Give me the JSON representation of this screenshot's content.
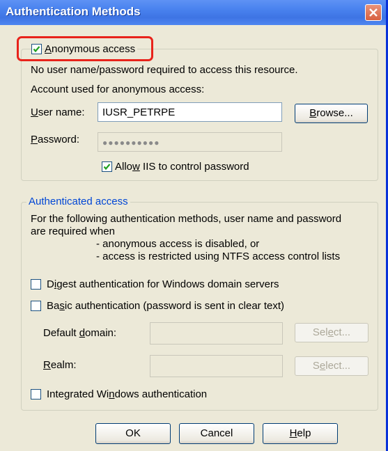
{
  "window": {
    "title": "Authentication Methods"
  },
  "anonymous": {
    "checkbox_label_pre": "",
    "checkbox_label_u": "A",
    "checkbox_label_post": "nonymous access",
    "checked": true,
    "description": "No user name/password required to access this resource.",
    "account_label": "Account used for anonymous access:",
    "username_label_u": "U",
    "username_label_post": "ser name:",
    "username_value": "IUSR_PETRPE",
    "browse_u": "B",
    "browse_post": "rowse...",
    "password_label_u": "P",
    "password_label_post": "assword:",
    "password_mask": "●●●●●●●●●●",
    "allow_pre": "Allo",
    "allow_u": "w",
    "allow_post": " IIS to control password",
    "allow_checked": true
  },
  "authenticated": {
    "legend": "Authenticated access",
    "desc_line1": "For the following authentication methods, user name and password",
    "desc_line2": "are required when",
    "desc_bullet1": "- anonymous access is disabled, or",
    "desc_bullet2": "- access is restricted using NTFS access control lists",
    "digest_pre": "D",
    "digest_u": "i",
    "digest_post": "gest authentication for Windows domain servers",
    "digest_checked": false,
    "basic_pre": "Ba",
    "basic_u": "s",
    "basic_post": "ic authentication (password is sent in clear text)",
    "basic_checked": false,
    "domain_pre": "Default ",
    "domain_u": "d",
    "domain_post": "omain:",
    "select1_pre": "Sel",
    "select1_u": "e",
    "select1_post": "ct...",
    "realm_u": "R",
    "realm_post": "ealm:",
    "select2_pre": "S",
    "select2_u": "e",
    "select2_post": "lect...",
    "integrated_pre": "Integrated Wi",
    "integrated_u": "n",
    "integrated_post": "dows authentication",
    "integrated_checked": false
  },
  "buttons": {
    "ok": "OK",
    "cancel": "Cancel",
    "help_u": "H",
    "help_post": "elp"
  },
  "colors": {
    "highlight": "#e8231b",
    "titlebar": "#3e74e4",
    "legend_text": "#0046d5"
  }
}
